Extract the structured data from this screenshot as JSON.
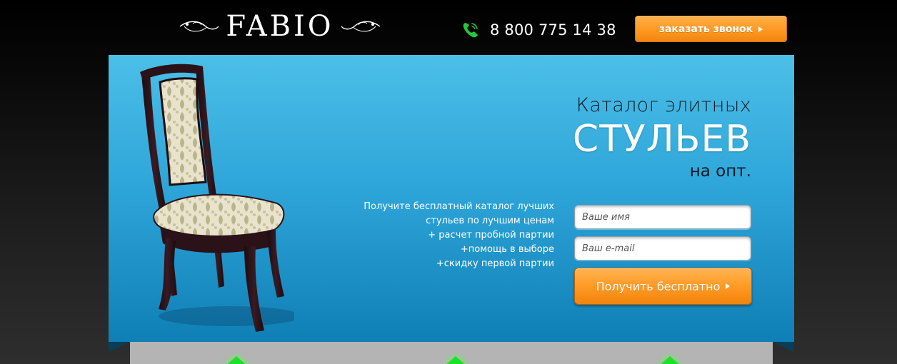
{
  "header": {
    "logo_text": "FABIO",
    "phone": "8 800 775 14 38",
    "callback_label": "заказать звонок",
    "icons": [
      "flourish-icon",
      "phone-icon",
      "arrow-right-icon"
    ]
  },
  "hero": {
    "title_line1": "Каталог элитных",
    "title_line2": "СТУЛЬЕВ",
    "title_line3": "на опт.",
    "benefits": [
      "Получите бесплатный каталог лучших",
      "стульев по лучшим ценам",
      "+ расчет пробной партии",
      "+помощь в выборе",
      "+скидку первой партии"
    ],
    "form": {
      "name_placeholder": "Ваше имя",
      "email_placeholder": "Ваш e-mail",
      "submit_label": "Получить бесплатно"
    }
  },
  "colors": {
    "accent_orange": "#ff9a25",
    "hero_blue_top": "#4bbfe7",
    "hero_blue_bottom": "#0f7fb5",
    "phone_green": "#22c83a",
    "marker_green": "#1fe028"
  }
}
